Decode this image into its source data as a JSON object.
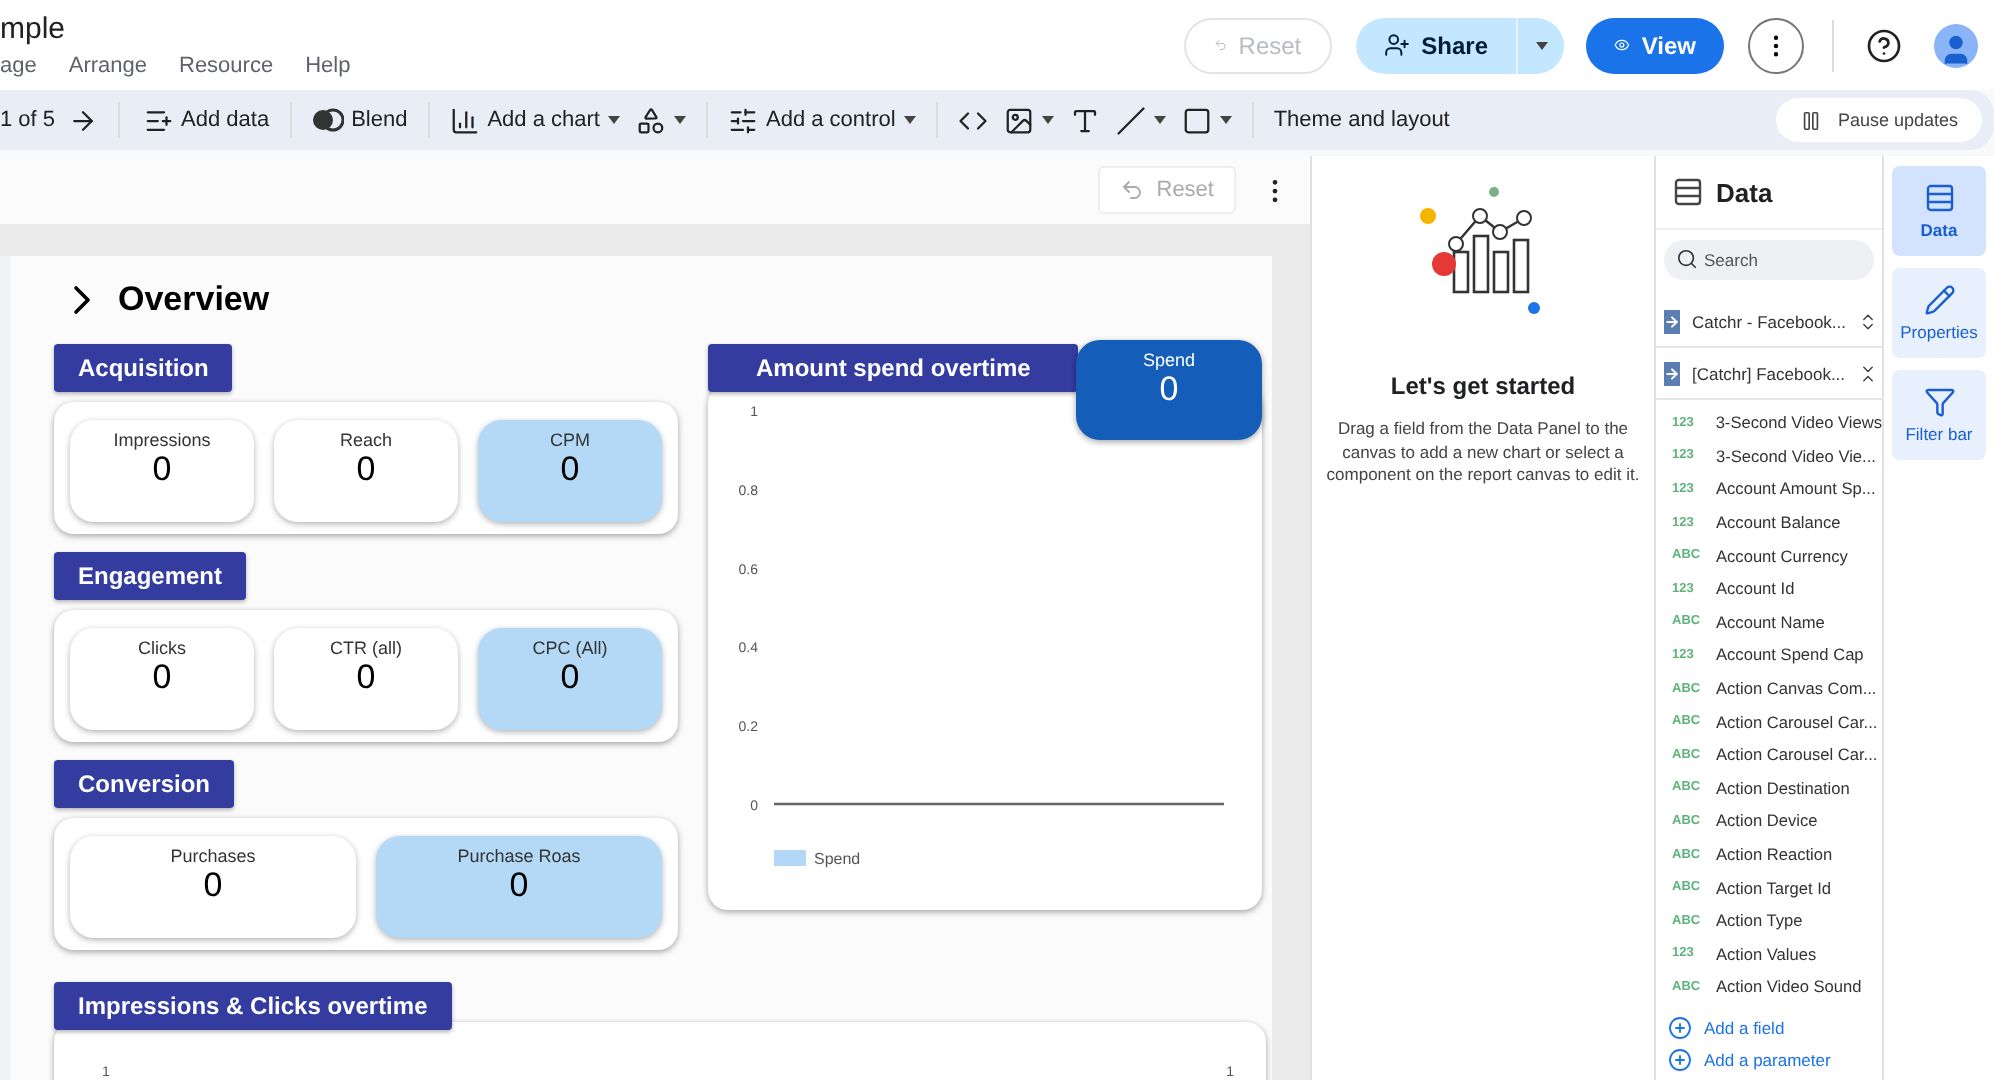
{
  "header": {
    "title": "mple",
    "menu": [
      "age",
      "Arrange",
      "Resource",
      "Help"
    ],
    "reset": {
      "label": "Reset",
      "disabled": true
    },
    "share": {
      "label": "Share"
    },
    "view": {
      "label": "View"
    }
  },
  "toolbar": {
    "page": "1 of 5",
    "items": [
      {
        "label": "Add data",
        "dropdown": false
      },
      {
        "label": "Blend",
        "dropdown": false
      },
      {
        "label": "Add a chart",
        "dropdown": true
      },
      {
        "dropdown": true
      },
      {
        "label": "Add a control",
        "dropdown": true
      },
      {
        "dropdown": false
      },
      {
        "dropdown": true
      },
      {
        "dropdown": false
      },
      {
        "dropdown": true
      },
      {
        "dropdown": true
      },
      {
        "label": "Theme and layout",
        "dropdown": false
      }
    ],
    "pause": "Pause updates"
  },
  "canvas": {
    "reset": {
      "label": "Reset",
      "disabled": true
    }
  },
  "report": {
    "title": "Overview",
    "sections": [
      {
        "title": "Acquisition",
        "cards": [
          {
            "label": "Impressions",
            "value": "0",
            "highlighted": false
          },
          {
            "label": "Reach",
            "value": "0",
            "highlighted": false
          },
          {
            "label": "CPM",
            "value": "0",
            "highlighted": true
          }
        ]
      },
      {
        "title": "Engagement",
        "cards": [
          {
            "label": "Clicks",
            "value": "0",
            "highlighted": false
          },
          {
            "label": "CTR (all)",
            "value": "0",
            "highlighted": false
          },
          {
            "label": "CPC (All)",
            "value": "0",
            "highlighted": true
          }
        ]
      },
      {
        "title": "Conversion",
        "cards": [
          {
            "label": "Purchases",
            "value": "0",
            "highlighted": false
          },
          {
            "label": "Purchase Roas",
            "value": "0",
            "highlighted": true
          }
        ]
      }
    ],
    "spend_chart": {
      "title": "Amount spend overtime",
      "chart_data": {
        "type": "bar",
        "ylim": [
          0,
          1
        ],
        "yticks": [
          0,
          0.2,
          0.4,
          0.6,
          0.8,
          1
        ],
        "series": [
          {
            "name": "Spend",
            "color": "#b3d7f7"
          }
        ]
      }
    },
    "spend_card": {
      "label": "Spend",
      "value": "0"
    },
    "bottom_chart": {
      "title": "Impressions & Clicks overtime",
      "left_ticks": [
        "1"
      ],
      "right_ticks": [
        "1"
      ]
    }
  },
  "start_panel": {
    "title": "Let's get started",
    "text": "Drag a field from the Data Panel to the canvas to add a new chart or select a component on the report canvas to edit it."
  },
  "data_panel": {
    "title": "Data",
    "search": {
      "placeholder": "Search"
    },
    "sources": [
      {
        "name": "Catchr - Facebook...",
        "expanded": false
      },
      {
        "name": "[Catchr] Facebook...",
        "expanded": true
      }
    ],
    "fields": [
      {
        "type": "123",
        "name": "3-Second Video Views"
      },
      {
        "type": "123",
        "name": "3-Second Video Vie..."
      },
      {
        "type": "123",
        "name": "Account Amount Sp..."
      },
      {
        "type": "123",
        "name": "Account Balance"
      },
      {
        "type": "ABC",
        "name": "Account Currency"
      },
      {
        "type": "123",
        "name": "Account Id"
      },
      {
        "type": "ABC",
        "name": "Account Name"
      },
      {
        "type": "123",
        "name": "Account Spend Cap"
      },
      {
        "type": "ABC",
        "name": "Action Canvas Com..."
      },
      {
        "type": "ABC",
        "name": "Action Carousel Car..."
      },
      {
        "type": "ABC",
        "name": "Action Carousel Car..."
      },
      {
        "type": "ABC",
        "name": "Action Destination"
      },
      {
        "type": "ABC",
        "name": "Action Device"
      },
      {
        "type": "ABC",
        "name": "Action Reaction"
      },
      {
        "type": "ABC",
        "name": "Action Target Id"
      },
      {
        "type": "ABC",
        "name": "Action Type"
      },
      {
        "type": "123",
        "name": "Action Values"
      },
      {
        "type": "ABC",
        "name": "Action Video Sound"
      }
    ],
    "actions": [
      "Add a field",
      "Add a parameter"
    ]
  },
  "rail": [
    {
      "label": "Data",
      "selected": true
    },
    {
      "label": "Properties",
      "selected": false
    },
    {
      "label": "Filter bar",
      "selected": false
    }
  ]
}
